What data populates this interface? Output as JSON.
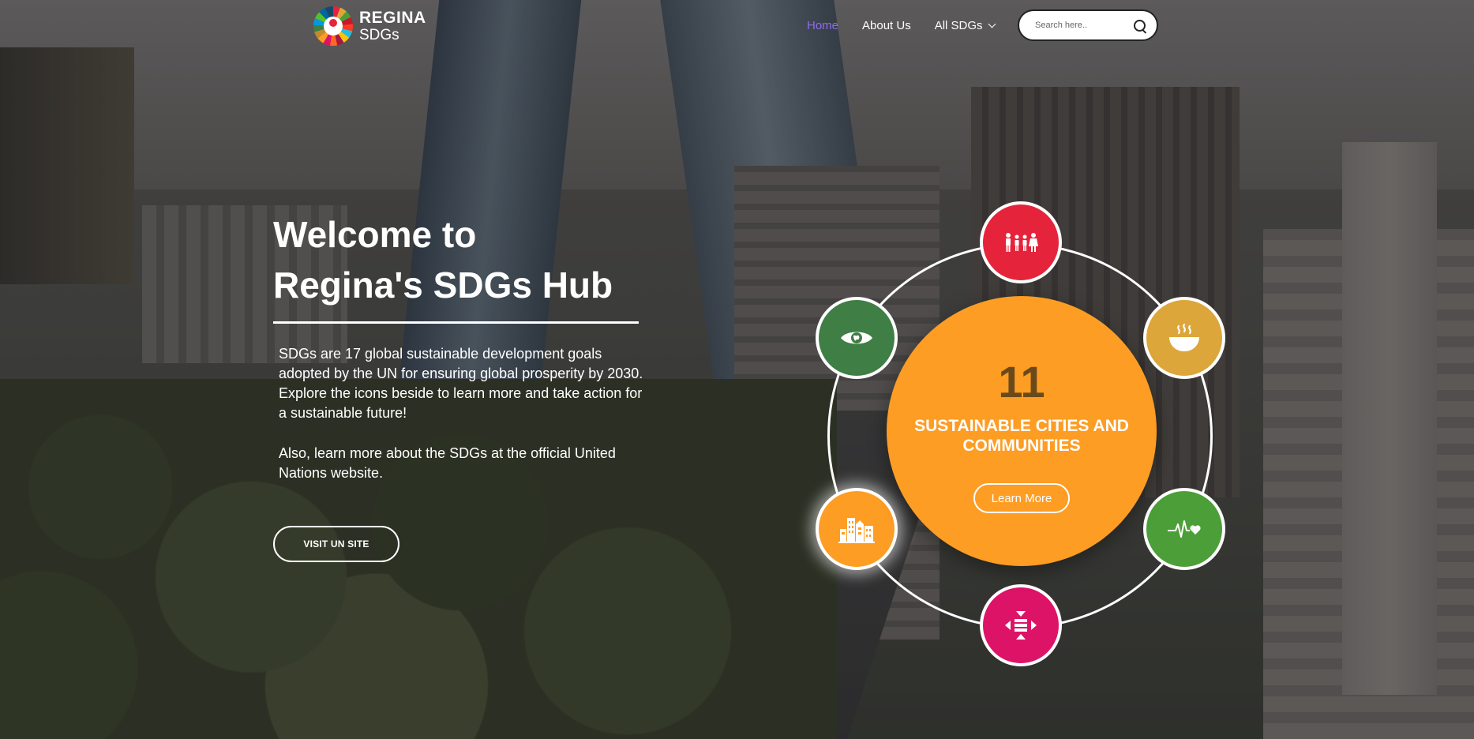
{
  "brand": {
    "line1": "REGINA",
    "line2": "SDGs"
  },
  "nav": {
    "home": "Home",
    "about": "About Us",
    "all_sdgs": "All SDGs"
  },
  "search": {
    "placeholder": "Search here.."
  },
  "hero": {
    "title_line1": "Welcome to",
    "title_line2": "Regina's SDGs Hub",
    "paragraph1": "SDGs are 17 global sustainable development goals adopted by the UN for ensuring global prosperity by 2030. Explore the icons beside to learn more and take action for a sustainable future!",
    "paragraph2": "Also, learn more about the SDGs at the official United Nations website.",
    "button": "VISIT UN SITE"
  },
  "featured_goal": {
    "number": "11",
    "title": "SUSTAINABLE CITIES AND COMMUNITIES",
    "button": "Learn More",
    "color": "#fd9d24"
  },
  "goal_icons": [
    {
      "icon": "family-icon",
      "color": "#e5243b"
    },
    {
      "icon": "bowl-icon",
      "color": "#dda63a"
    },
    {
      "icon": "heartbeat-icon",
      "color": "#4c9f38"
    },
    {
      "icon": "equality-icon",
      "color": "#dd1367"
    },
    {
      "icon": "city-icon",
      "color": "#fd9d24",
      "selected": true
    },
    {
      "icon": "eye-globe-icon",
      "color": "#3f7e44"
    }
  ],
  "colors": {
    "nav_active": "#8e6cf0"
  }
}
